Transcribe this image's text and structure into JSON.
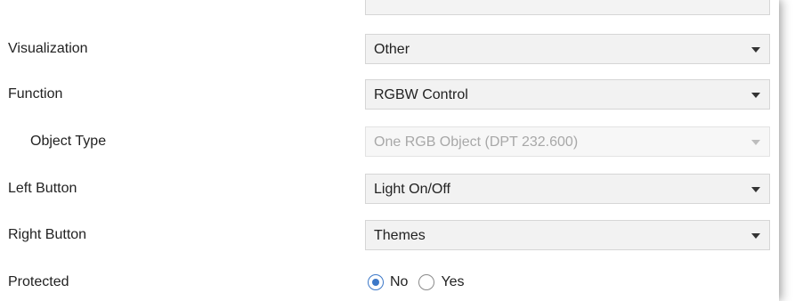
{
  "form": {
    "visualization": {
      "label": "Visualization",
      "value": "Other"
    },
    "function": {
      "label": "Function",
      "value": "RGBW Control"
    },
    "object_type": {
      "label": "Object Type",
      "value": "One RGB Object (DPT 232.600)",
      "disabled": true
    },
    "left_button": {
      "label": "Left Button",
      "value": "Light On/Off"
    },
    "right_button": {
      "label": "Right Button",
      "value": "Themes"
    },
    "protected": {
      "label": "Protected",
      "options": [
        "No",
        "Yes"
      ],
      "selected": "No"
    }
  },
  "icons": {
    "dropdown": "chevron-down-icon",
    "radio": "radio-icon"
  },
  "colors": {
    "radio_selected": "#3c78c8",
    "disabled_text": "#a8a8a8",
    "field_background": "#f2f2f2"
  }
}
